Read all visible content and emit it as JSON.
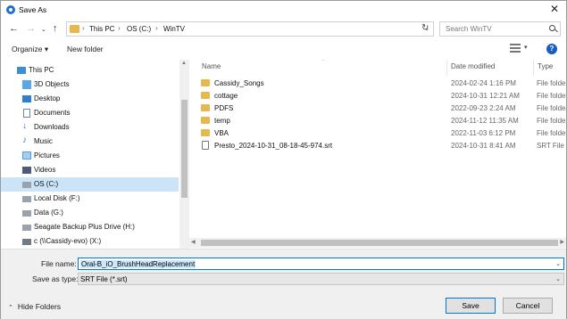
{
  "window": {
    "title": "Save As"
  },
  "address": {
    "segments": [
      "This PC",
      "OS (C:)",
      "WinTV"
    ]
  },
  "search": {
    "placeholder": "Search WinTV"
  },
  "toolbar": {
    "organize_label": "Organize ▾",
    "new_folder_label": "New folder"
  },
  "sidebar": {
    "items": [
      {
        "label": "This PC",
        "icon": "pc-icon"
      },
      {
        "label": "3D Objects",
        "icon": "3d-objects-icon"
      },
      {
        "label": "Desktop",
        "icon": "desktop-icon"
      },
      {
        "label": "Documents",
        "icon": "documents-icon"
      },
      {
        "label": "Downloads",
        "icon": "downloads-icon"
      },
      {
        "label": "Music",
        "icon": "music-icon"
      },
      {
        "label": "Pictures",
        "icon": "pictures-icon"
      },
      {
        "label": "Videos",
        "icon": "videos-icon"
      },
      {
        "label": "OS (C:)",
        "icon": "drive-icon",
        "selected": true
      },
      {
        "label": "Local Disk (F:)",
        "icon": "drive-icon"
      },
      {
        "label": "Data (G:)",
        "icon": "drive-icon"
      },
      {
        "label": "Seagate Backup Plus Drive (H:)",
        "icon": "drive-icon"
      },
      {
        "label": "c (\\\\Cassidy-evo) (X:)",
        "icon": "network-drive-icon"
      }
    ]
  },
  "columns": {
    "name": "Name",
    "date": "Date modified",
    "type": "Type"
  },
  "files": [
    {
      "name": "Cassidy_Songs",
      "date": "2024-02-24 1:16 PM",
      "type": "File folde",
      "kind": "folder"
    },
    {
      "name": "cottage",
      "date": "2024-10-31 12:21 AM",
      "type": "File folde",
      "kind": "folder"
    },
    {
      "name": "PDFS",
      "date": "2022-09-23 2:24 AM",
      "type": "File folde",
      "kind": "folder"
    },
    {
      "name": "temp",
      "date": "2024-11-12 11:35 AM",
      "type": "File folde",
      "kind": "folder"
    },
    {
      "name": "VBA",
      "date": "2022-11-03 6:12 PM",
      "type": "File folde",
      "kind": "folder"
    },
    {
      "name": "Presto_2024-10-31_08-18-45-974.srt",
      "date": "2024-10-31 8:41 AM",
      "type": "SRT File",
      "kind": "file"
    }
  ],
  "form": {
    "filename_label": "File name:",
    "filename_value": "Oral-B_iO_BrushHeadReplacement",
    "saveas_label": "Save as type:",
    "saveas_value": "SRT File (*.srt)"
  },
  "footer": {
    "hide_folders_label": "Hide Folders",
    "save_label": "Save",
    "cancel_label": "Cancel"
  },
  "colors": {
    "accent": "#0078d7",
    "selection": "#cce4f7",
    "folder": "#e8b94a"
  }
}
